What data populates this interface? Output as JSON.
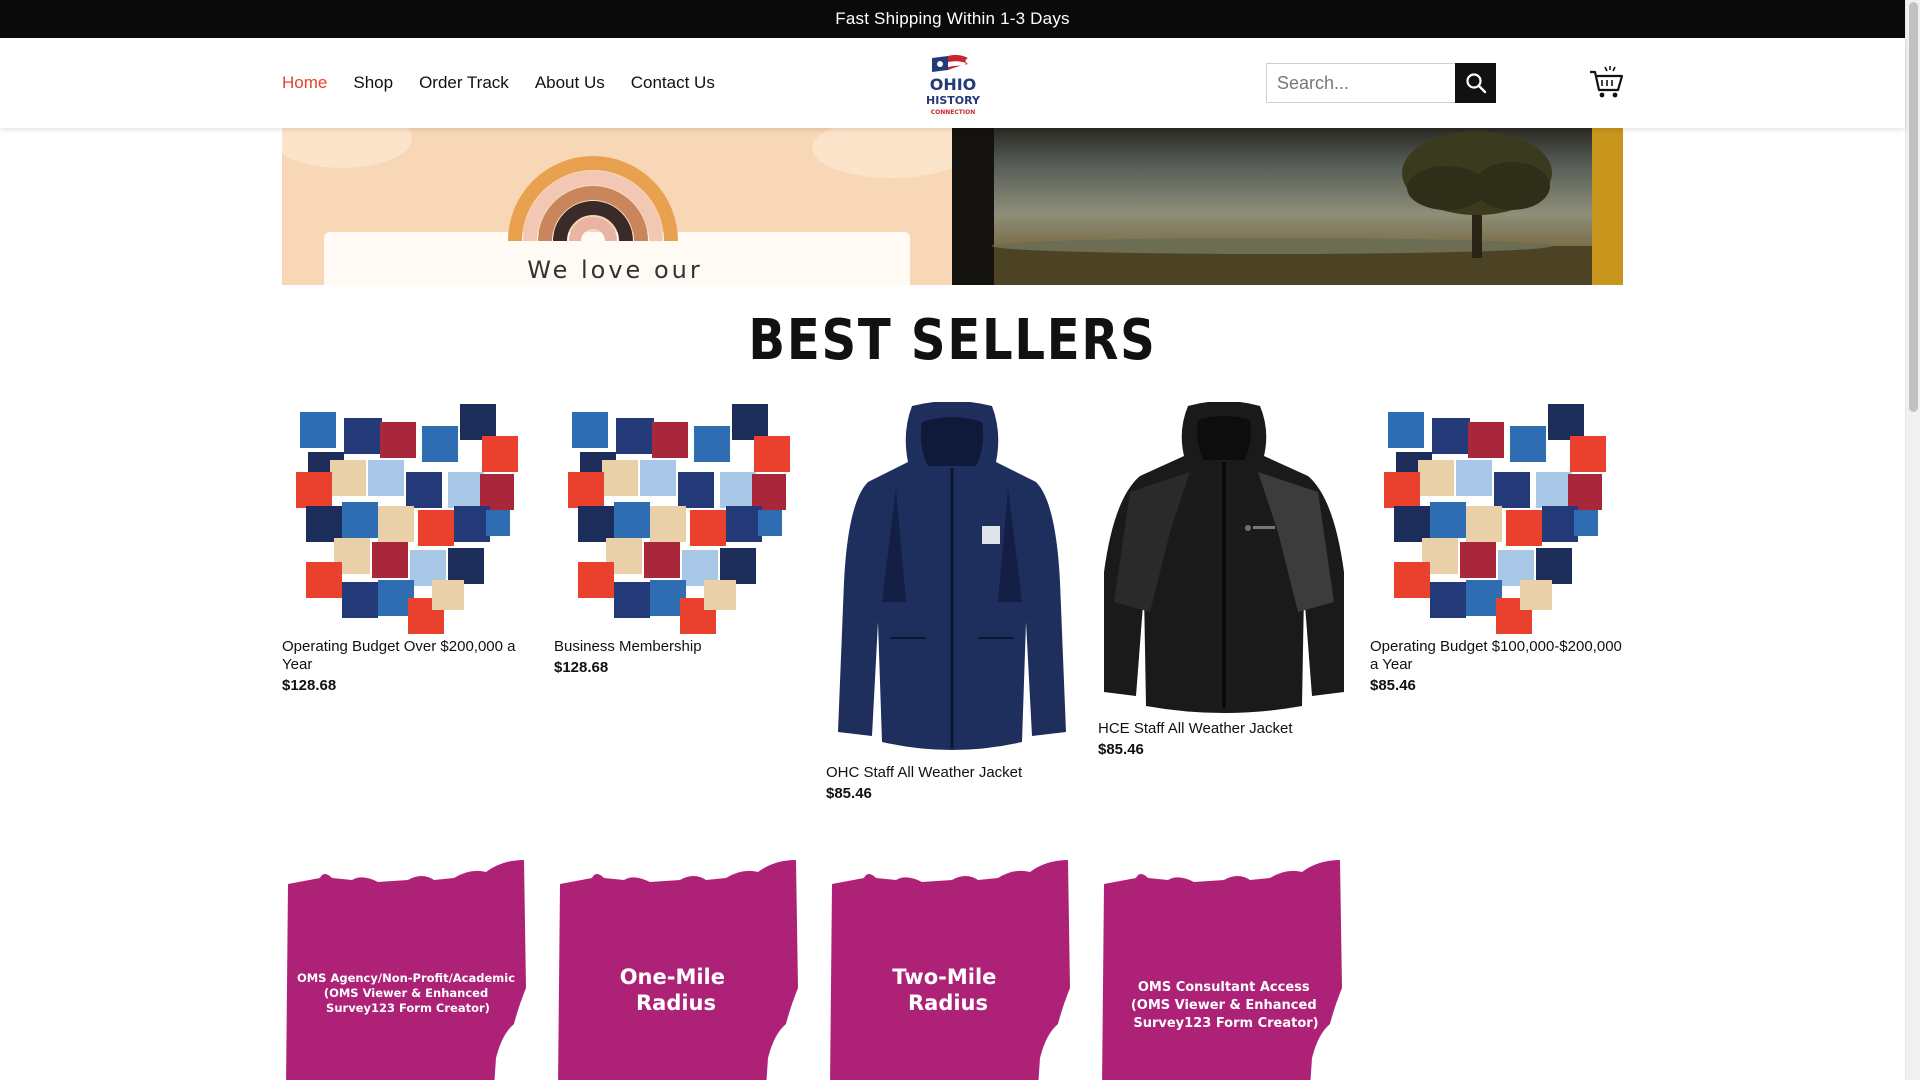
{
  "announcement": "Fast Shipping Within 1-3 Days",
  "nav": {
    "items": [
      {
        "label": "Home",
        "active": true
      },
      {
        "label": "Shop"
      },
      {
        "label": "Order Track"
      },
      {
        "label": "About Us"
      },
      {
        "label": "Contact Us"
      }
    ]
  },
  "logo": {
    "line1": "OHIO",
    "line2": "HISTORY",
    "line3": "CONNECTION"
  },
  "search": {
    "placeholder": "Search..."
  },
  "banner": {
    "text": "We love our"
  },
  "best_sellers": {
    "title": "BEST SELLERS",
    "products": [
      {
        "name": "Operating Budget Over $200,000 a Year",
        "price": "$128.68",
        "image": "patchwork-heart"
      },
      {
        "name": "Business Membership",
        "price": "$128.68",
        "image": "patchwork-heart"
      },
      {
        "name": "OHC Staff All Weather Jacket",
        "price": "$85.46",
        "image": "navy-jacket"
      },
      {
        "name": "HCE Staff All Weather Jacket",
        "price": "$85.46",
        "image": "black-jacket"
      },
      {
        "name": "Operating Budget $100,000-$200,000 a Year",
        "price": "$85.46",
        "image": "patchwork-heart"
      }
    ]
  },
  "more_products": [
    {
      "lines": [
        "OMS Agency/Non-Profit/Academic",
        "(OMS Viewer & Enhanced",
        "Survey123 Form Creator)"
      ]
    },
    {
      "lines": [
        "One-Mile",
        "Radius"
      ]
    },
    {
      "lines": [
        "Two-Mile",
        "Radius"
      ]
    },
    {
      "lines": [
        "OMS Consultant Access",
        "(OMS Viewer & Enhanced",
        "Survey123 Form Creator)"
      ]
    }
  ],
  "colors": {
    "accent": "#e0452a",
    "magenta": "#ad2277",
    "heart_palette": [
      "#2f6db3",
      "#243a78",
      "#a8273a",
      "#e9412e",
      "#e9d0a8",
      "#a9c7e6",
      "#1c2d5a"
    ]
  }
}
